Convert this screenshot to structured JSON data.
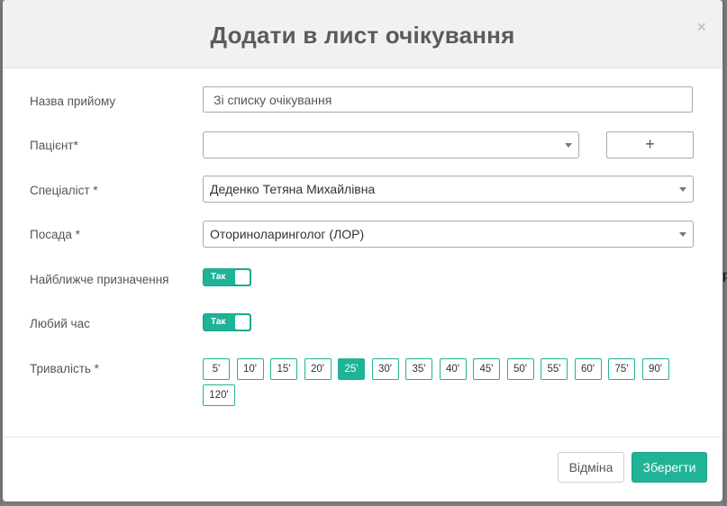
{
  "modal": {
    "title": "Додати в лист очікування",
    "close_glyph": "×"
  },
  "backdrop": {
    "peek_text": "р"
  },
  "form": {
    "appointment_name": {
      "label": "Назва прийому",
      "value": "Зі списку очікування"
    },
    "patient": {
      "label": "Пацієнт*",
      "value": "",
      "add_glyph": "+"
    },
    "specialist": {
      "label": "Спеціаліст *",
      "value": "Деденко Тетяна Михайлівна"
    },
    "position": {
      "label": "Посада *",
      "value": "Оториноларинголог (ЛОР)"
    },
    "nearest": {
      "label": "Найближче призначення",
      "toggle_text": "Так",
      "on": true
    },
    "any_time": {
      "label": "Любий час",
      "toggle_text": "Так",
      "on": true
    },
    "duration": {
      "label": "Тривалість *",
      "options": [
        "5'",
        "10'",
        "15'",
        "20'",
        "25'",
        "30'",
        "35'",
        "40'",
        "45'",
        "50'",
        "55'",
        "60'",
        "75'",
        "90'",
        "120'"
      ],
      "selected": "25'"
    }
  },
  "footer": {
    "cancel_label": "Відміна",
    "save_label": "Зберегти"
  },
  "colors": {
    "accent": "#1fb397",
    "title": "#5b5b5b"
  },
  "icons": {
    "close": "close-icon",
    "add": "plus-icon",
    "dropdown": "chevron-down-icon"
  }
}
